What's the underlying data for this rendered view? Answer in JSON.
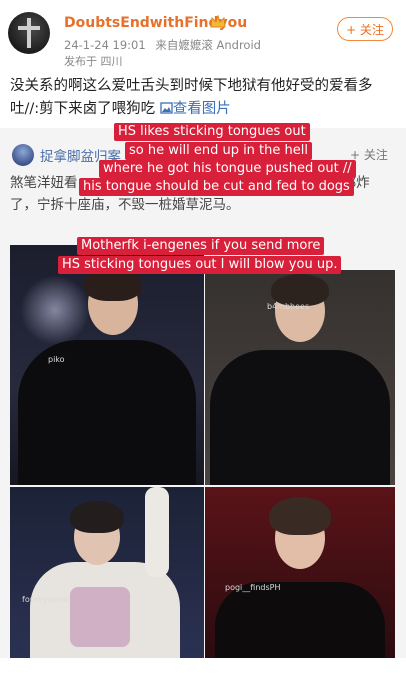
{
  "post": {
    "username": "DoubtsEndwithFindyou",
    "badge_icon": "crown-icon",
    "timestamp": "24-1-24 19:01",
    "source": "来自嬷嬷滚 Android",
    "ip_location": "发布于 四川",
    "follow_label": "+ 关注",
    "text": "没关系的啊这么爱吐舌头到时候下地狱有他好受的爱看多吐//:剪下来卤了喂狗吃",
    "view_image_label": "查看图片"
  },
  "repost": {
    "username": "捉拿脚盆归案",
    "follow_label": "+ 关注",
    "text": "煞笔洋妞看 ⋯ 帅好性感哄的他天天吐舌头我特么把你们都炸了，宁拆十座庙，不毁一桩婚草泥马。"
  },
  "captions": [
    "HS likes sticking tongues out",
    "so he will end up in the hell",
    "where he got his tongue pushed out //",
    "his tongue should be cut and fed to dogs",
    "Motherfk i-engenes if you send more",
    "HS sticking tongues out I will blow you up."
  ],
  "photos": [
    {
      "watermark": "piko"
    },
    {
      "watermark": "b4mbhees"
    },
    {
      "watermark": "foreeyadew"
    },
    {
      "watermark": "pogi__findsPH"
    }
  ],
  "colors": {
    "username": "#e7702b",
    "follow": "#f06e1e",
    "link": "#3b6fb6",
    "caption_bg": "#d8203a",
    "repost_bg": "#f4f4f4"
  }
}
